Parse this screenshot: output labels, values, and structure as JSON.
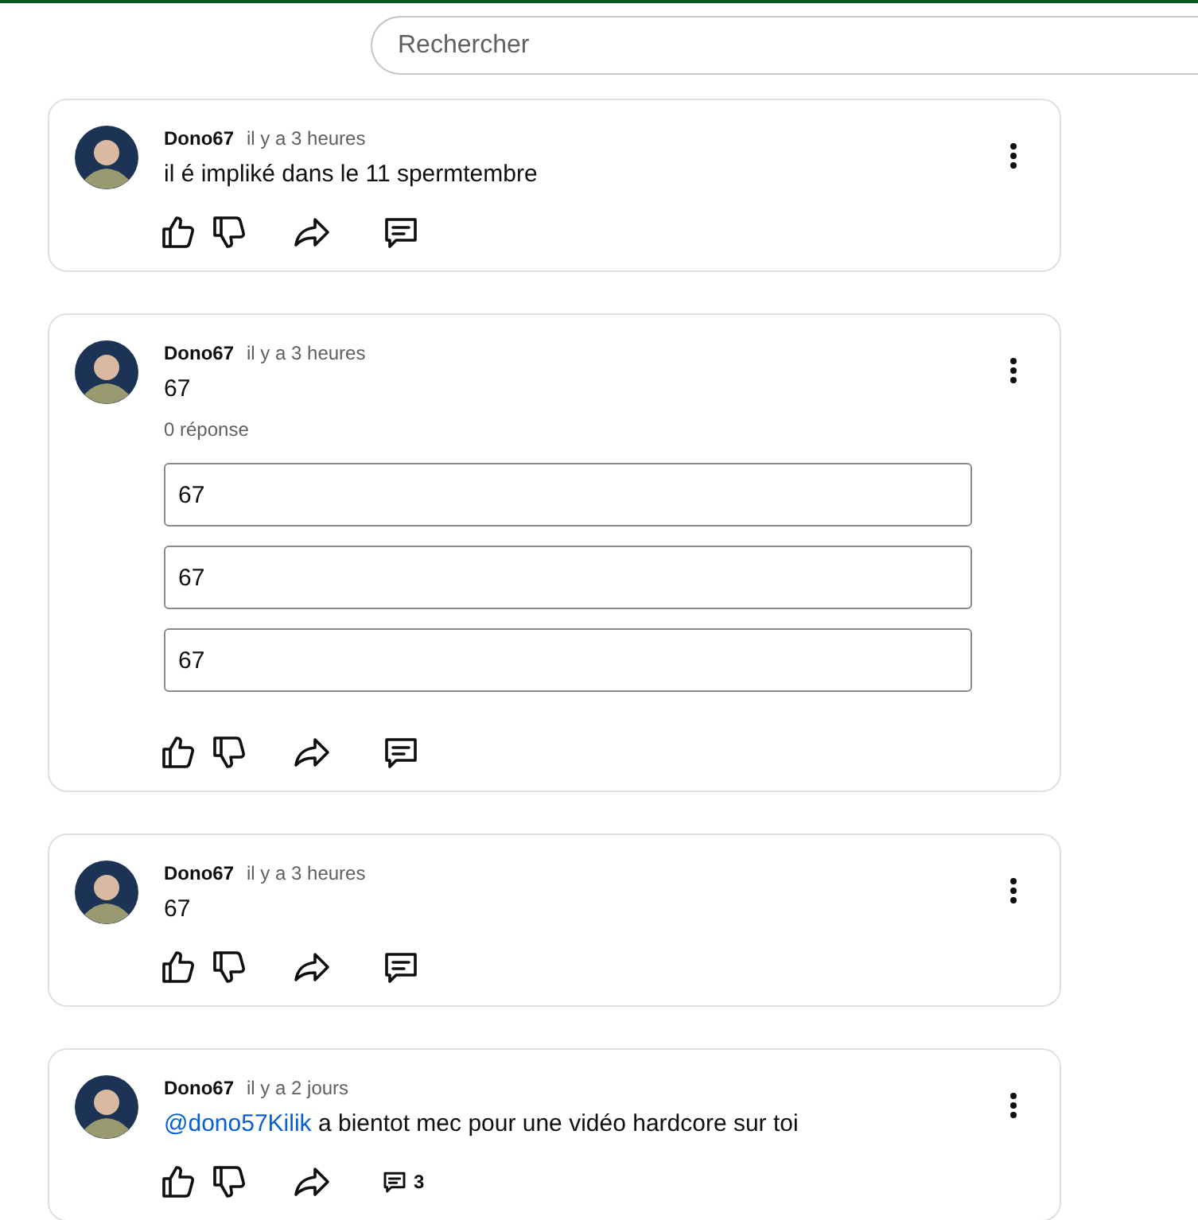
{
  "search": {
    "placeholder": "Rechercher"
  },
  "comments": [
    {
      "author": "Dono67",
      "time": "il y a 3 heures",
      "text": "il é impliké dans le 11 spermtembre"
    },
    {
      "author": "Dono67",
      "time": "il y a 3 heures",
      "text": "67",
      "reply_count": "0 réponse",
      "replies": [
        {
          "value": "67"
        },
        {
          "value": "67"
        },
        {
          "value": "67"
        }
      ]
    },
    {
      "author": "Dono67",
      "time": "il y a 3 heures",
      "text": "67"
    },
    {
      "author": "Dono67",
      "time": "il y a 2 jours",
      "mention": "@dono57Kilik",
      "text": "a bientot mec pour une vidéo hardcore sur toi",
      "comment_count": "3"
    }
  ]
}
